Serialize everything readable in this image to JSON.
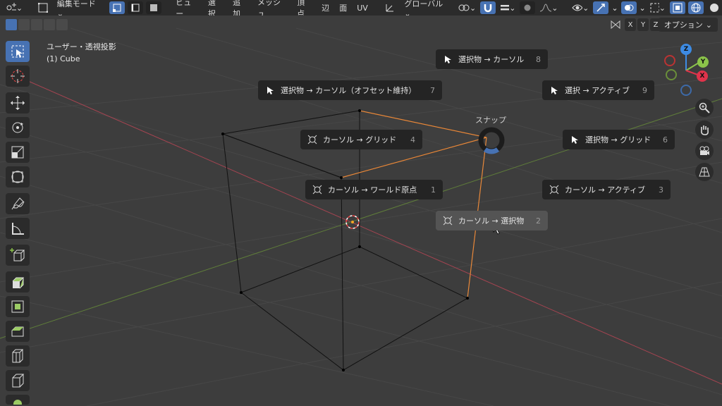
{
  "header": {
    "mode_label": "編集モード",
    "menus": [
      "ビュー",
      "選択",
      "追加",
      "メッシュ",
      "頂点",
      "辺",
      "面",
      "UV"
    ],
    "transform_orientation": "グローバル"
  },
  "axis_buttons": [
    "X",
    "Y",
    "Z"
  ],
  "options_label": "オプション",
  "viewport": {
    "view_name": "ユーザー・透視投影",
    "object_name": "(1) Cube"
  },
  "snap_menu": {
    "title": "スナップ",
    "items": [
      {
        "label": "選択物 → カーソル",
        "num": "8",
        "icon": "arrow"
      },
      {
        "label": "選択物 → カーソル（オフセット維持）",
        "num": "7",
        "icon": "arrow"
      },
      {
        "label": "選択 → アクティブ",
        "num": "9",
        "icon": "arrow"
      },
      {
        "label": "カーソル → グリッド",
        "num": "4",
        "icon": "cursor"
      },
      {
        "label": "選択物 → グリッド",
        "num": "6",
        "icon": "arrow"
      },
      {
        "label": "カーソル → ワールド原点",
        "num": "1",
        "icon": "cursor"
      },
      {
        "label": "カーソル → アクティブ",
        "num": "3",
        "icon": "cursor"
      },
      {
        "label": "カーソル → 選択物",
        "num": "2",
        "icon": "cursor"
      }
    ]
  },
  "gizmo": {
    "z": "Z",
    "y": "Y",
    "x": "X"
  },
  "colors": {
    "accent": "#4772b3",
    "x_axis": "#e0334b",
    "y_axis": "#8bc34a",
    "z_axis": "#3d8be4",
    "edge_active": "#e8883a"
  }
}
